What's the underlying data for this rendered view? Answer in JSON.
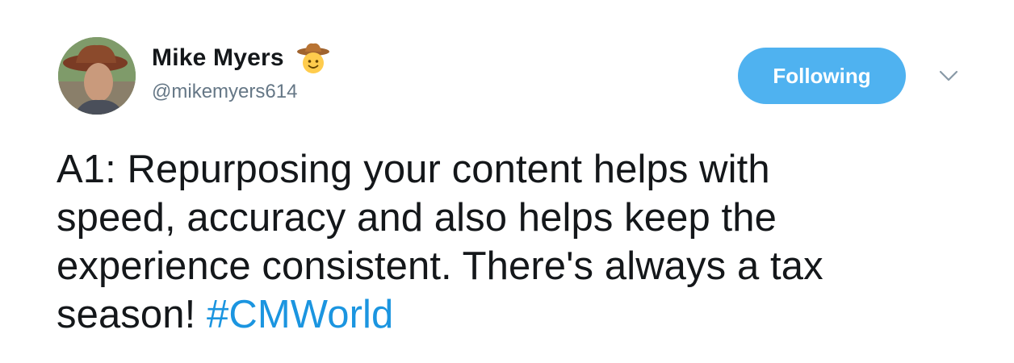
{
  "author": {
    "display_name": "Mike Myers",
    "handle": "@mikemyers614",
    "name_emoji": "cowboy-hat-face-emoji"
  },
  "follow_button": {
    "label": "Following",
    "color": "#4fb2f0"
  },
  "more_menu": {
    "icon": "chevron-down-icon"
  },
  "tweet": {
    "text_lines": [
      "A1: Repurposing your content helps with",
      "speed, accuracy and also helps keep the",
      "experience consistent. There's always a tax",
      "season! "
    ],
    "hashtag": "#CMWorld",
    "hashtag_color": "#1b95e0"
  }
}
